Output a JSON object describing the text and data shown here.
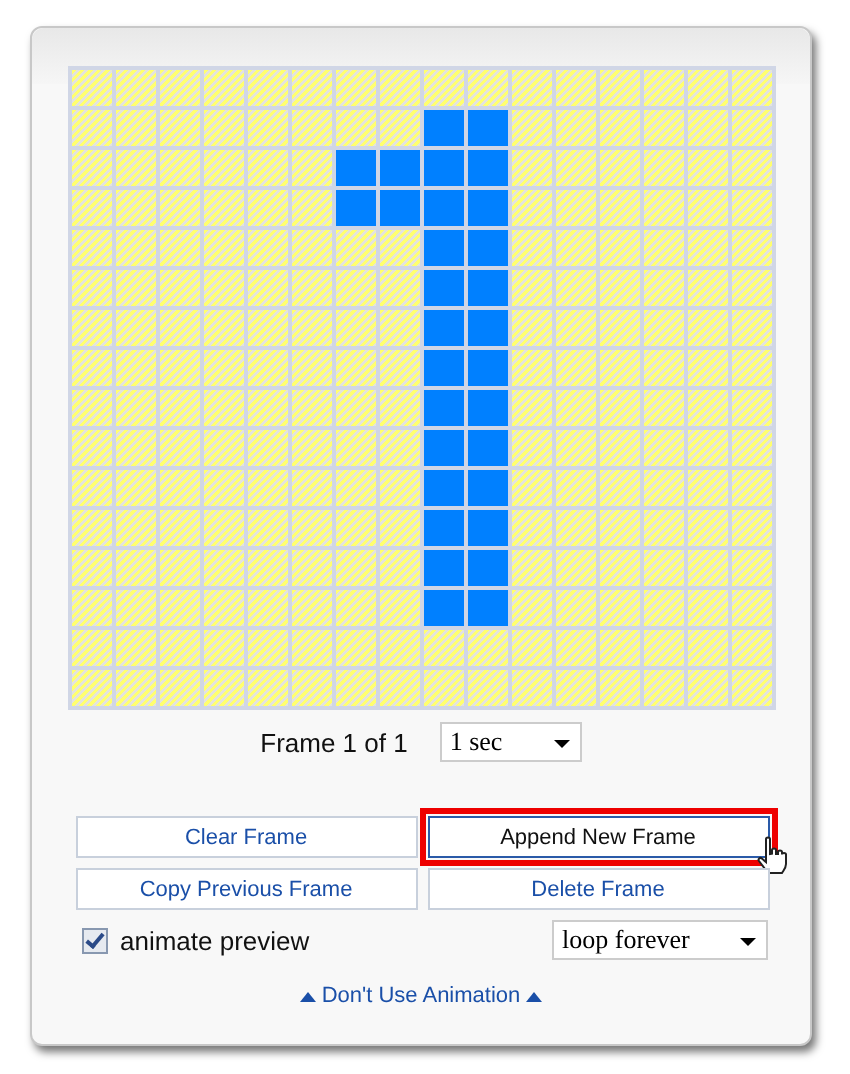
{
  "grid": {
    "rows": [
      {
        "cells": [
          false,
          false,
          false,
          false,
          false,
          false,
          false,
          false,
          false,
          false,
          false,
          false,
          false,
          false,
          false,
          false
        ]
      },
      {
        "cells": [
          false,
          false,
          false,
          false,
          false,
          false,
          false,
          false,
          true,
          true,
          false,
          false,
          false,
          false,
          false,
          false
        ]
      },
      {
        "cells": [
          false,
          false,
          false,
          false,
          false,
          false,
          true,
          true,
          true,
          true,
          false,
          false,
          false,
          false,
          false,
          false
        ]
      },
      {
        "cells": [
          false,
          false,
          false,
          false,
          false,
          false,
          true,
          true,
          true,
          true,
          false,
          false,
          false,
          false,
          false,
          false
        ]
      },
      {
        "cells": [
          false,
          false,
          false,
          false,
          false,
          false,
          false,
          false,
          true,
          true,
          false,
          false,
          false,
          false,
          false,
          false
        ]
      },
      {
        "cells": [
          false,
          false,
          false,
          false,
          false,
          false,
          false,
          false,
          true,
          true,
          false,
          false,
          false,
          false,
          false,
          false
        ]
      },
      {
        "cells": [
          false,
          false,
          false,
          false,
          false,
          false,
          false,
          false,
          true,
          true,
          false,
          false,
          false,
          false,
          false,
          false
        ]
      },
      {
        "cells": [
          false,
          false,
          false,
          false,
          false,
          false,
          false,
          false,
          true,
          true,
          false,
          false,
          false,
          false,
          false,
          false
        ]
      },
      {
        "cells": [
          false,
          false,
          false,
          false,
          false,
          false,
          false,
          false,
          true,
          true,
          false,
          false,
          false,
          false,
          false,
          false
        ]
      },
      {
        "cells": [
          false,
          false,
          false,
          false,
          false,
          false,
          false,
          false,
          true,
          true,
          false,
          false,
          false,
          false,
          false,
          false
        ]
      },
      {
        "cells": [
          false,
          false,
          false,
          false,
          false,
          false,
          false,
          false,
          true,
          true,
          false,
          false,
          false,
          false,
          false,
          false
        ]
      },
      {
        "cells": [
          false,
          false,
          false,
          false,
          false,
          false,
          false,
          false,
          true,
          true,
          false,
          false,
          false,
          false,
          false,
          false
        ]
      },
      {
        "cells": [
          false,
          false,
          false,
          false,
          false,
          false,
          false,
          false,
          true,
          true,
          false,
          false,
          false,
          false,
          false,
          false
        ]
      },
      {
        "cells": [
          false,
          false,
          false,
          false,
          false,
          false,
          false,
          false,
          true,
          true,
          false,
          false,
          false,
          false,
          false,
          false
        ]
      },
      {
        "cells": [
          false,
          false,
          false,
          false,
          false,
          false,
          false,
          false,
          false,
          false,
          false,
          false,
          false,
          false,
          false,
          false
        ]
      },
      {
        "cells": [
          false,
          false,
          false,
          false,
          false,
          false,
          false,
          false,
          false,
          false,
          false,
          false,
          false,
          false,
          false,
          false
        ]
      }
    ]
  },
  "frame": {
    "label": "Frame 1 of 1",
    "duration": "1 sec"
  },
  "buttons": [
    {
      "label": "Clear Frame",
      "highlighted": false
    },
    {
      "label": "Append New Frame",
      "highlighted": true
    },
    {
      "label": "Copy Previous Frame",
      "highlighted": false
    },
    {
      "label": "Delete Frame",
      "highlighted": false
    }
  ],
  "animate_preview": {
    "label": "animate preview",
    "checked": true
  },
  "loop": {
    "value": "loop forever"
  },
  "link": {
    "label": "Don't Use Animation"
  }
}
